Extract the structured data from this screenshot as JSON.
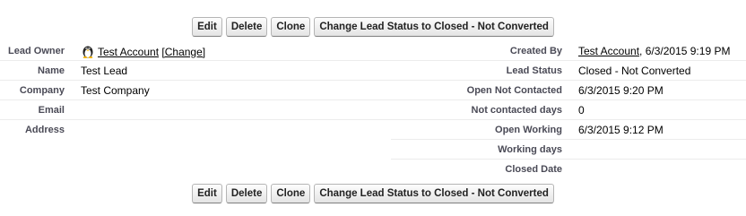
{
  "buttons": {
    "edit": "Edit",
    "delete": "Delete",
    "clone": "Clone",
    "change_status": "Change Lead Status to Closed - Not Converted"
  },
  "left_fields": [
    {
      "label": "Lead Owner",
      "value": "Test Account",
      "change_link": "[Change]"
    },
    {
      "label": "Name",
      "value": "Test Lead"
    },
    {
      "label": "Company",
      "value": "Test Company"
    },
    {
      "label": "Email",
      "value": ""
    },
    {
      "label": "Address",
      "value": ""
    }
  ],
  "right_fields": [
    {
      "label": "Created By",
      "value": "Test Account",
      "value_suffix": ", 6/3/2015 9:19 PM"
    },
    {
      "label": "Lead Status",
      "value": "Closed - Not Converted"
    },
    {
      "label": "Open Not Contacted",
      "value": "6/3/2015 9:20 PM"
    },
    {
      "label": "Not contacted days",
      "value": "0"
    },
    {
      "label": "Open Working",
      "value": "6/3/2015 9:12 PM"
    },
    {
      "label": "Working days",
      "value": ""
    },
    {
      "label": "Closed Date",
      "value": ""
    }
  ],
  "icons": {
    "owner_icon": "penguin-user-icon"
  }
}
